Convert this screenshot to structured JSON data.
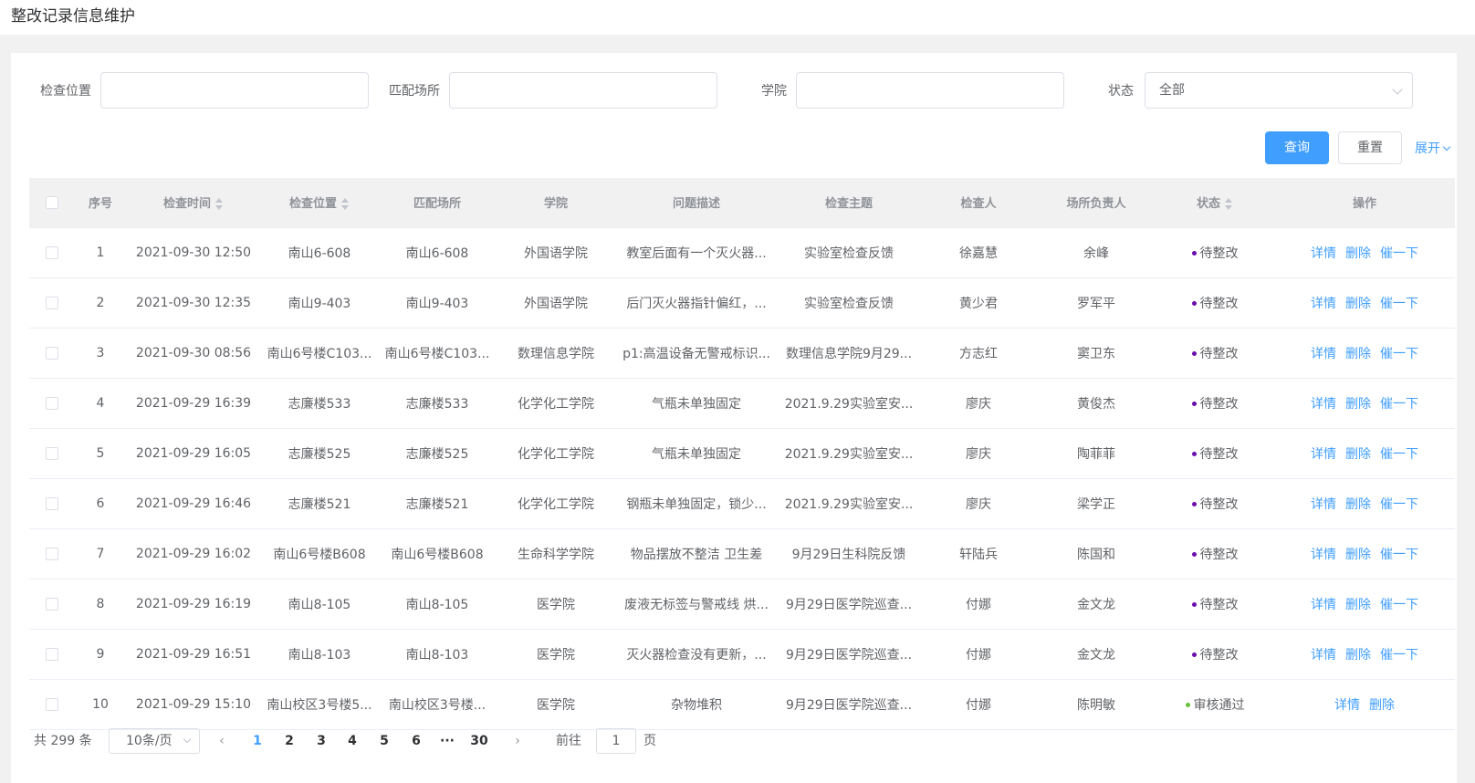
{
  "page_title": "整改记录信息维护",
  "filters": {
    "location_label": "检查位置",
    "location_value": "",
    "place_label": "匹配场所",
    "place_value": "",
    "college_label": "学院",
    "college_value": "",
    "status_label": "状态",
    "status_value": "全部"
  },
  "actions": {
    "query": "查询",
    "reset": "重置",
    "expand": "展开"
  },
  "columns": [
    "序号",
    "检查时间",
    "检查位置",
    "匹配场所",
    "学院",
    "问题描述",
    "检查主题",
    "检查人",
    "场所负责人",
    "状态",
    "操作"
  ],
  "colors": {
    "pending": "#6a0dad",
    "approved": "#67c23a",
    "link": "#409eff"
  },
  "rows": [
    {
      "no": "1",
      "time": "2021-09-30 12:50",
      "location": "南山6-608",
      "place": "南山6-608",
      "college": "外国语学院",
      "desc": "教室后面有一个灭火器...",
      "topic": "实验室检查反馈",
      "inspector": "徐嘉慧",
      "owner": "余峰",
      "status": "待整改",
      "ops": [
        "详情",
        "删除",
        "催一下"
      ]
    },
    {
      "no": "2",
      "time": "2021-09-30 12:35",
      "location": "南山9-403",
      "place": "南山9-403",
      "college": "外国语学院",
      "desc": "后门灭火器指针偏红，...",
      "topic": "实验室检查反馈",
      "inspector": "黄少君",
      "owner": "罗军平",
      "status": "待整改",
      "ops": [
        "详情",
        "删除",
        "催一下"
      ]
    },
    {
      "no": "3",
      "time": "2021-09-30 08:56",
      "location": "南山6号楼C103...",
      "place": "南山6号楼C103...",
      "college": "数理信息学院",
      "desc": "p1:高温设备无警戒标识...",
      "topic": "数理信息学院9月29...",
      "inspector": "方志红",
      "owner": "窦卫东",
      "status": "待整改",
      "ops": [
        "详情",
        "删除",
        "催一下"
      ]
    },
    {
      "no": "4",
      "time": "2021-09-29 16:39",
      "location": "志廉楼533",
      "place": "志廉楼533",
      "college": "化学化工学院",
      "desc": "气瓶未单独固定",
      "topic": "2021.9.29实验室安...",
      "inspector": "廖庆",
      "owner": "黄俊杰",
      "status": "待整改",
      "ops": [
        "详情",
        "删除",
        "催一下"
      ]
    },
    {
      "no": "5",
      "time": "2021-09-29 16:05",
      "location": "志廉楼525",
      "place": "志廉楼525",
      "college": "化学化工学院",
      "desc": "气瓶未单独固定",
      "topic": "2021.9.29实验室安...",
      "inspector": "廖庆",
      "owner": "陶菲菲",
      "status": "待整改",
      "ops": [
        "详情",
        "删除",
        "催一下"
      ]
    },
    {
      "no": "6",
      "time": "2021-09-29 16:46",
      "location": "志廉楼521",
      "place": "志廉楼521",
      "college": "化学化工学院",
      "desc": "钢瓶未单独固定，锁少...",
      "topic": "2021.9.29实验室安...",
      "inspector": "廖庆",
      "owner": "梁学正",
      "status": "待整改",
      "ops": [
        "详情",
        "删除",
        "催一下"
      ]
    },
    {
      "no": "7",
      "time": "2021-09-29 16:02",
      "location": "南山6号楼B608",
      "place": "南山6号楼B608",
      "college": "生命科学学院",
      "desc": "物品摆放不整洁 卫生差",
      "topic": "9月29日生科院反馈",
      "inspector": "轩陆兵",
      "owner": "陈国和",
      "status": "待整改",
      "ops": [
        "详情",
        "删除",
        "催一下"
      ]
    },
    {
      "no": "8",
      "time": "2021-09-29 16:19",
      "location": "南山8-105",
      "place": "南山8-105",
      "college": "医学院",
      "desc": "废液无标签与警戒线 烘...",
      "topic": "9月29日医学院巡查...",
      "inspector": "付娜",
      "owner": "金文龙",
      "status": "待整改",
      "ops": [
        "详情",
        "删除",
        "催一下"
      ]
    },
    {
      "no": "9",
      "time": "2021-09-29 16:51",
      "location": "南山8-103",
      "place": "南山8-103",
      "college": "医学院",
      "desc": "灭火器检查没有更新，...",
      "topic": "9月29日医学院巡查...",
      "inspector": "付娜",
      "owner": "金文龙",
      "status": "待整改",
      "ops": [
        "详情",
        "删除",
        "催一下"
      ]
    },
    {
      "no": "10",
      "time": "2021-09-29 15:10",
      "location": "南山校区3号楼5...",
      "place": "南山校区3号楼...",
      "college": "医学院",
      "desc": "杂物堆积",
      "topic": "9月29日医学院巡查...",
      "inspector": "付娜",
      "owner": "陈明敏",
      "status": "审核通过",
      "ops": [
        "详情",
        "删除"
      ]
    }
  ],
  "pagination": {
    "total": "共 299 条",
    "page_size": "10条/页",
    "pages": [
      "1",
      "2",
      "3",
      "4",
      "5",
      "6",
      "···",
      "30"
    ],
    "current": "1",
    "goto_label": "前往",
    "goto_value": "1",
    "goto_suffix": "页"
  }
}
